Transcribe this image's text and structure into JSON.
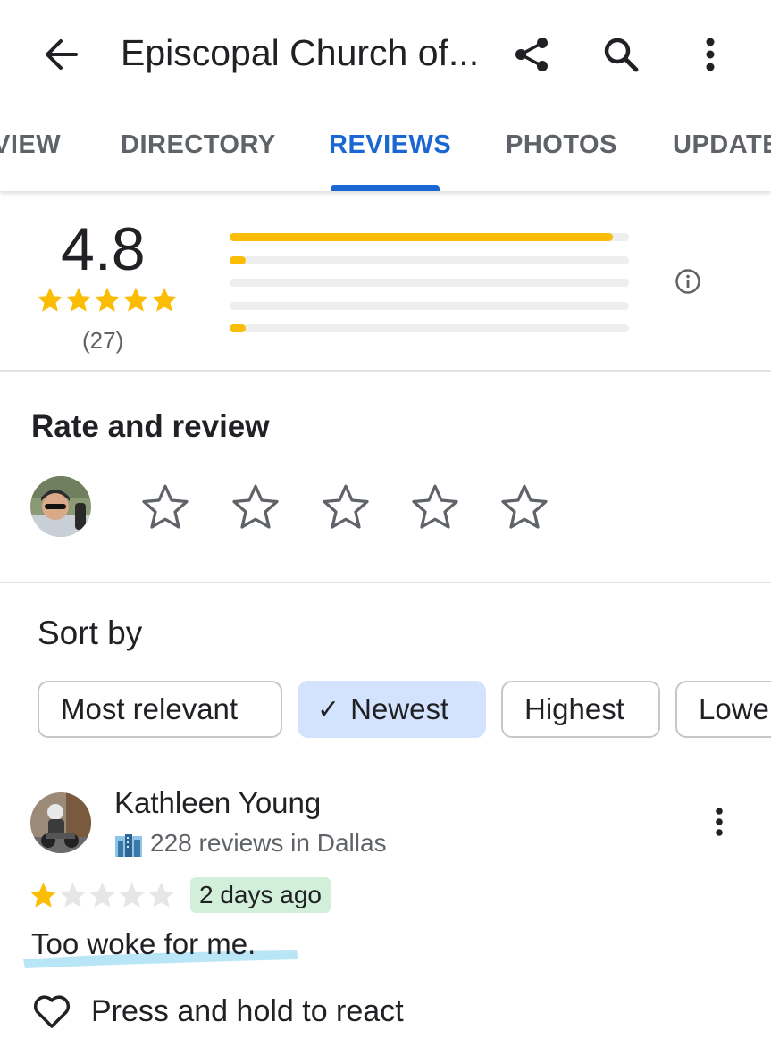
{
  "header": {
    "title": "Episcopal Church of...",
    "back_icon": "arrow-back-icon",
    "share_icon": "share-icon",
    "search_icon": "search-icon",
    "more_icon": "more-vert-icon"
  },
  "tabs": [
    {
      "label": "VIEW",
      "active": false
    },
    {
      "label": "DIRECTORY",
      "active": false
    },
    {
      "label": "REVIEWS",
      "active": true
    },
    {
      "label": "PHOTOS",
      "active": false
    },
    {
      "label": "UPDATE",
      "active": false
    }
  ],
  "summary": {
    "rating": "4.8",
    "count": "(27)",
    "distribution": [
      0.96,
      0.04,
      0.0,
      0.0,
      0.04
    ]
  },
  "rate_review": {
    "title": "Rate and review"
  },
  "sort": {
    "label": "Sort by",
    "options": [
      "Most relevant",
      "Newest",
      "Highest",
      "Lowe"
    ],
    "selected": "Newest",
    "check": "✓"
  },
  "review": {
    "author": "Kathleen Young",
    "meta": "228 reviews in Dallas",
    "stars": 1,
    "time": "2 days ago",
    "text": "Too woke for me.",
    "react_label": "Press and hold to react"
  },
  "colors": {
    "accent": "#1a66d2",
    "star": "#fbbc04",
    "chip_selected": "#d3e3fd",
    "badge": "#d2f0d9"
  }
}
